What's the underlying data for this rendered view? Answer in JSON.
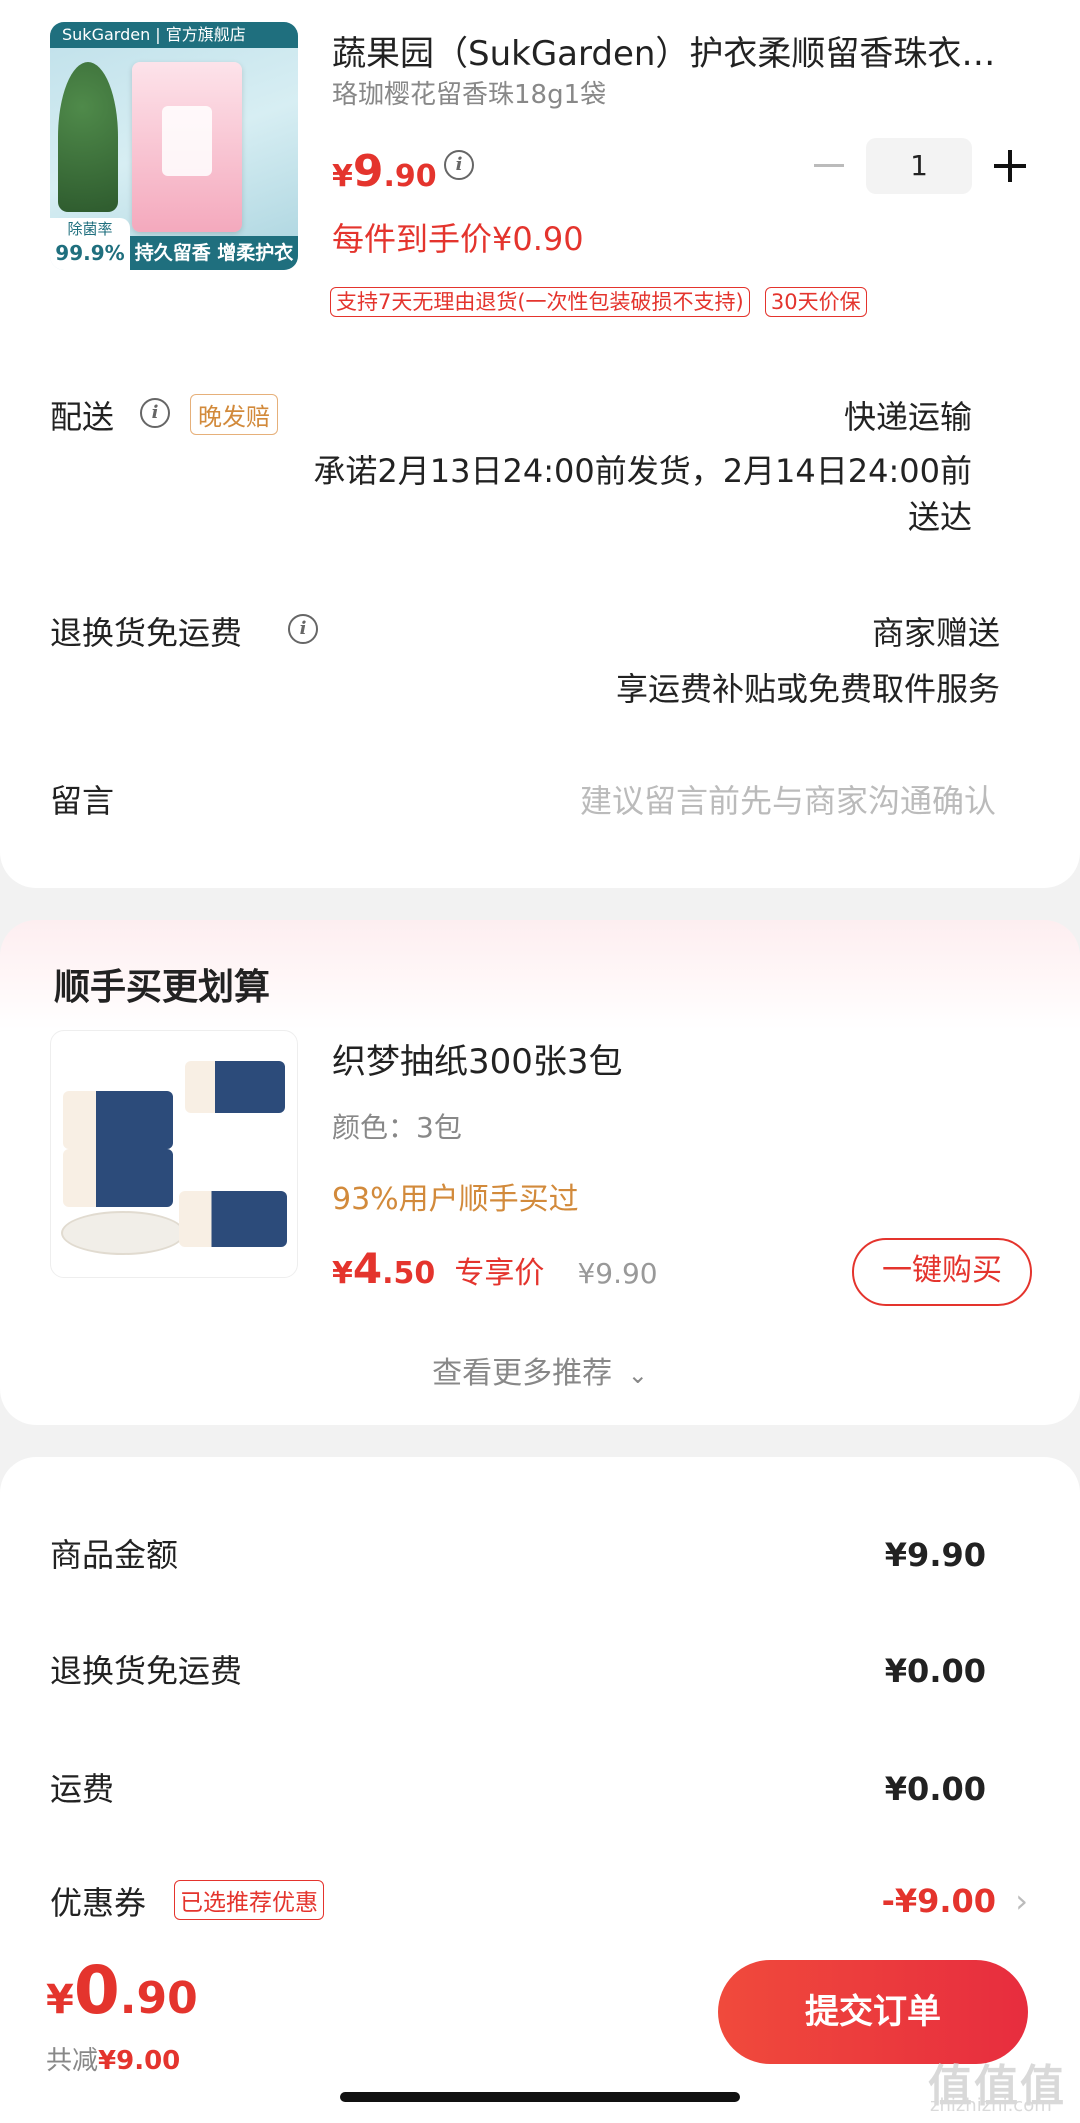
{
  "product": {
    "title": "蔬果园（SukGarden）护衣柔顺留香珠衣…",
    "spec": "珞珈樱花留香珠18g1袋",
    "price_symbol": "¥",
    "price_int": "9",
    "price_dec": ".90",
    "final_price_text": "每件到手价¥0.90",
    "quantity": "1",
    "tags": [
      "支持7天无理由退货(一次性包装破损不支持)",
      "30天价保"
    ],
    "image": {
      "brand": "SukGarden | 官方旗舰店",
      "rate_label": "除菌率",
      "rate_value": "99.9%",
      "slogan": "持久留香 增柔护衣"
    }
  },
  "delivery": {
    "label": "配送",
    "late_tag": "晚发赔",
    "method": "快递运输",
    "promise_line1": "承诺2月13日24:00前发货，2月14日24:00前",
    "promise_line2": "送达"
  },
  "return_shipping": {
    "label": "退换货免运费",
    "value": "商家赠送",
    "desc": "享运费补贴或免费取件服务"
  },
  "message": {
    "label": "留言",
    "placeholder": "建议留言前先与商家沟通确认"
  },
  "recommend": {
    "title": "顺手买更划算",
    "item_name": "织梦抽纸300张3包",
    "item_spec": "颜色：3包",
    "item_hint": "93%用户顺手买过",
    "price_symbol": "¥",
    "price_int": "4",
    "price_dec": ".50",
    "price_label": "专享价",
    "original_price": "¥9.90",
    "buy_button": "一键购买",
    "more_link": "查看更多推荐"
  },
  "summary": {
    "rows": [
      {
        "label": "商品金额",
        "value": "¥9.90"
      },
      {
        "label": "退换货免运费",
        "value": "¥0.00"
      },
      {
        "label": "运费",
        "value": "¥0.00"
      }
    ],
    "coupon_label": "优惠券",
    "coupon_tag": "已选推荐优惠",
    "coupon_value": "-¥9.00"
  },
  "bottom": {
    "price_symbol": "¥",
    "price_int": "0",
    "price_dec": ".90",
    "reduce_label": "共减",
    "reduce_value": "¥9.00",
    "submit": "提交订单"
  },
  "watermark": {
    "main": "值值值",
    "sub": "zhizhizhi.com"
  },
  "colors": {
    "accent": "#e4342d",
    "late_tag": "#d28a3b",
    "recommend_hint": "#d28a3b"
  }
}
